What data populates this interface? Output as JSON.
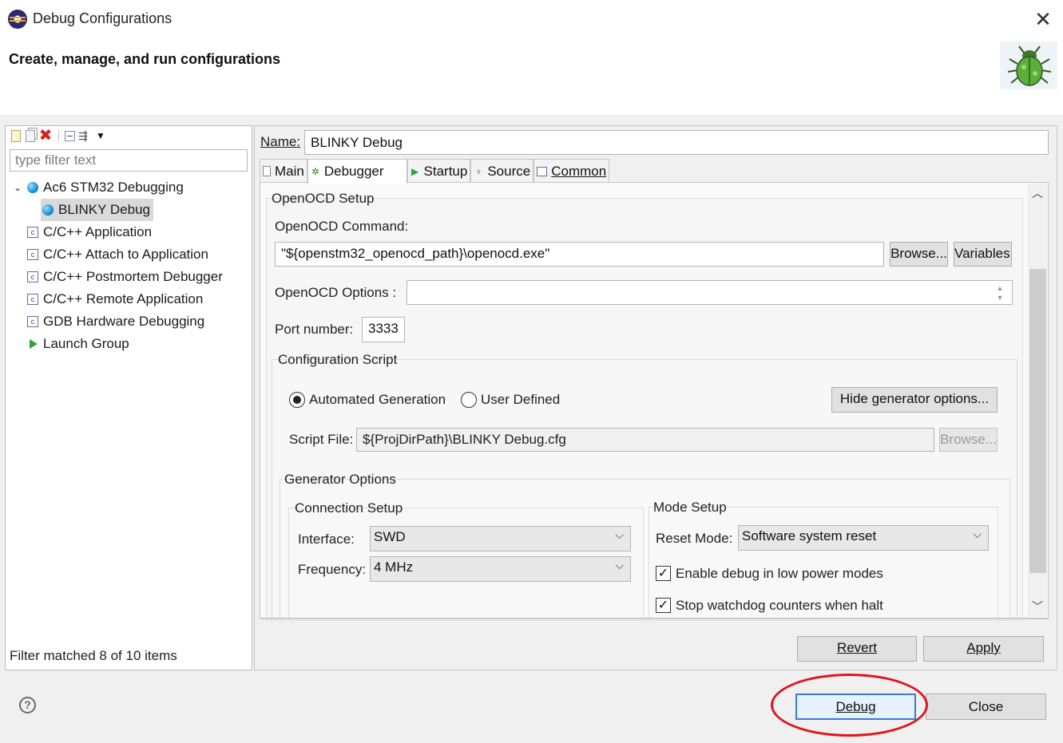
{
  "window": {
    "title": "Debug Configurations",
    "header": "Create, manage, and run configurations"
  },
  "left": {
    "filter_placeholder": "type filter text",
    "tree": [
      {
        "label": "Ac6 STM32 Debugging",
        "icon": "debug-config-icon",
        "expanded": true
      },
      {
        "label": "BLINKY Debug",
        "icon": "debug-config-icon",
        "selected": true
      },
      {
        "label": "C/C++ Application",
        "icon": "c-config-icon"
      },
      {
        "label": "C/C++ Attach to Application",
        "icon": "c-config-icon"
      },
      {
        "label": "C/C++ Postmortem Debugger",
        "icon": "c-config-icon"
      },
      {
        "label": "C/C++ Remote Application",
        "icon": "c-config-icon"
      },
      {
        "label": "GDB Hardware Debugging",
        "icon": "c-config-icon"
      },
      {
        "label": "Launch Group",
        "icon": "launch-group-icon"
      }
    ],
    "status": "Filter matched 8 of 10 items"
  },
  "right": {
    "name_label": "Name:",
    "name_value": "BLINKY Debug",
    "tabs": [
      {
        "label": "Main",
        "icon": "main-tab-icon"
      },
      {
        "label": "Debugger",
        "icon": "debugger-tab-icon",
        "active": true
      },
      {
        "label": "Startup",
        "icon": "startup-tab-icon"
      },
      {
        "label": "Source",
        "icon": "source-tab-icon"
      },
      {
        "label": "Common",
        "icon": "common-tab-icon"
      }
    ],
    "openocd": {
      "group_title": "OpenOCD Setup",
      "command_label": "OpenOCD Command:",
      "command_value": "\"${openstm32_openocd_path}\\openocd.exe\"",
      "browse_label": "Browse...",
      "variables_label": "Variables...",
      "options_label": "OpenOCD Options :",
      "options_value": "",
      "port_label": "Port number:",
      "port_value": "3333"
    },
    "config_script": {
      "group_title": "Configuration Script",
      "radio_auto": "Automated Generation",
      "radio_user": "User Defined",
      "hide_btn": "Hide generator options...",
      "script_label": "Script File:",
      "script_value": "${ProjDirPath}\\BLINKY Debug.cfg",
      "browse_label": "Browse..."
    },
    "generator": {
      "group_title": "Generator Options",
      "connection": {
        "title": "Connection Setup",
        "interface_label": "Interface:",
        "interface_value": "SWD",
        "frequency_label": "Frequency:",
        "frequency_value": "4 MHz"
      },
      "mode": {
        "title": "Mode Setup",
        "reset_label": "Reset Mode:",
        "reset_value": "Software system reset",
        "check1": "Enable debug in low power modes",
        "check2": "Stop watchdog counters when halt"
      }
    },
    "revert_label": "Revert",
    "apply_label": "Apply"
  },
  "footer": {
    "debug_label": "Debug",
    "close_label": "Close"
  },
  "colors": {
    "annotation": "#e0141d",
    "default_button_border": "#3b7ad8"
  }
}
